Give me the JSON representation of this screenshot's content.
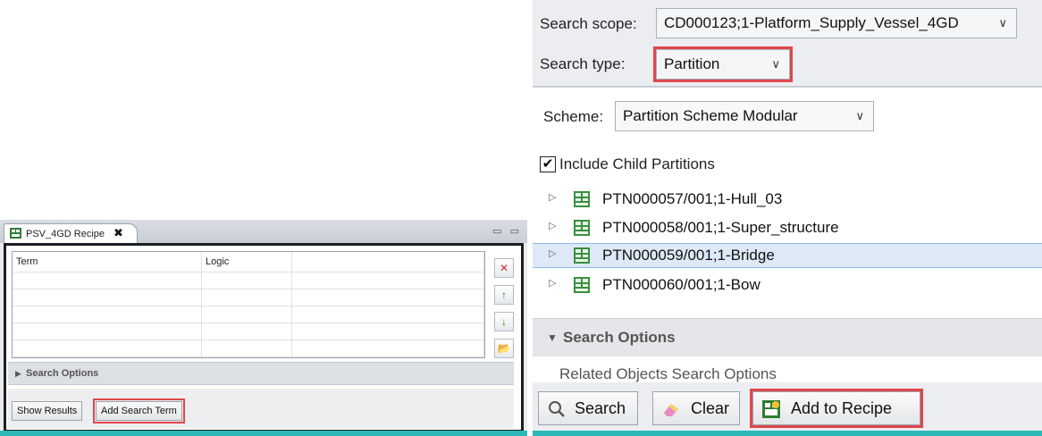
{
  "recipe": {
    "tab_title": "PSV_4GD Recipe",
    "tab_close": "✖",
    "window_controls": "▭ ▭",
    "columns": [
      "Term",
      "Logic",
      ""
    ],
    "rows": [
      [
        "",
        "",
        ""
      ],
      [
        "",
        "",
        ""
      ],
      [
        "",
        "",
        ""
      ],
      [
        "",
        "",
        ""
      ],
      [
        "",
        "",
        ""
      ]
    ],
    "side_buttons": {
      "remove": "✕",
      "move_up": "↑",
      "move_down": "↓",
      "open": "📂"
    },
    "search_options_label": "Search Options",
    "show_results_label": "Show Results",
    "add_search_term_label": "Add Search Term"
  },
  "search": {
    "scope_label": "Search scope:",
    "scope_value": "CD000123;1-Platform_Supply_Vessel_4GD",
    "type_label": "Search type:",
    "type_value": "Partition",
    "scheme_label": "Scheme:",
    "scheme_value": "Partition Scheme Modular",
    "include_child_label": "Include Child Partitions",
    "include_child_checked": "✔",
    "tree": [
      {
        "label": "PTN000057/001;1-Hull_03",
        "selected": false
      },
      {
        "label": "PTN000058/001;1-Super_structure",
        "selected": false
      },
      {
        "label": "PTN000059/001;1-Bridge",
        "selected": true
      },
      {
        "label": "PTN000060/001;1-Bow",
        "selected": false
      }
    ],
    "search_options_label": "Search Options",
    "related_options_label": "Related Objects Search Options",
    "search_button": "Search",
    "clear_button": "Clear",
    "add_to_recipe_button": "Add to Recipe"
  },
  "colors": {
    "highlight": "#e0464b",
    "accent_teal": "#2cb8b8",
    "selection": "#dde9f6"
  }
}
